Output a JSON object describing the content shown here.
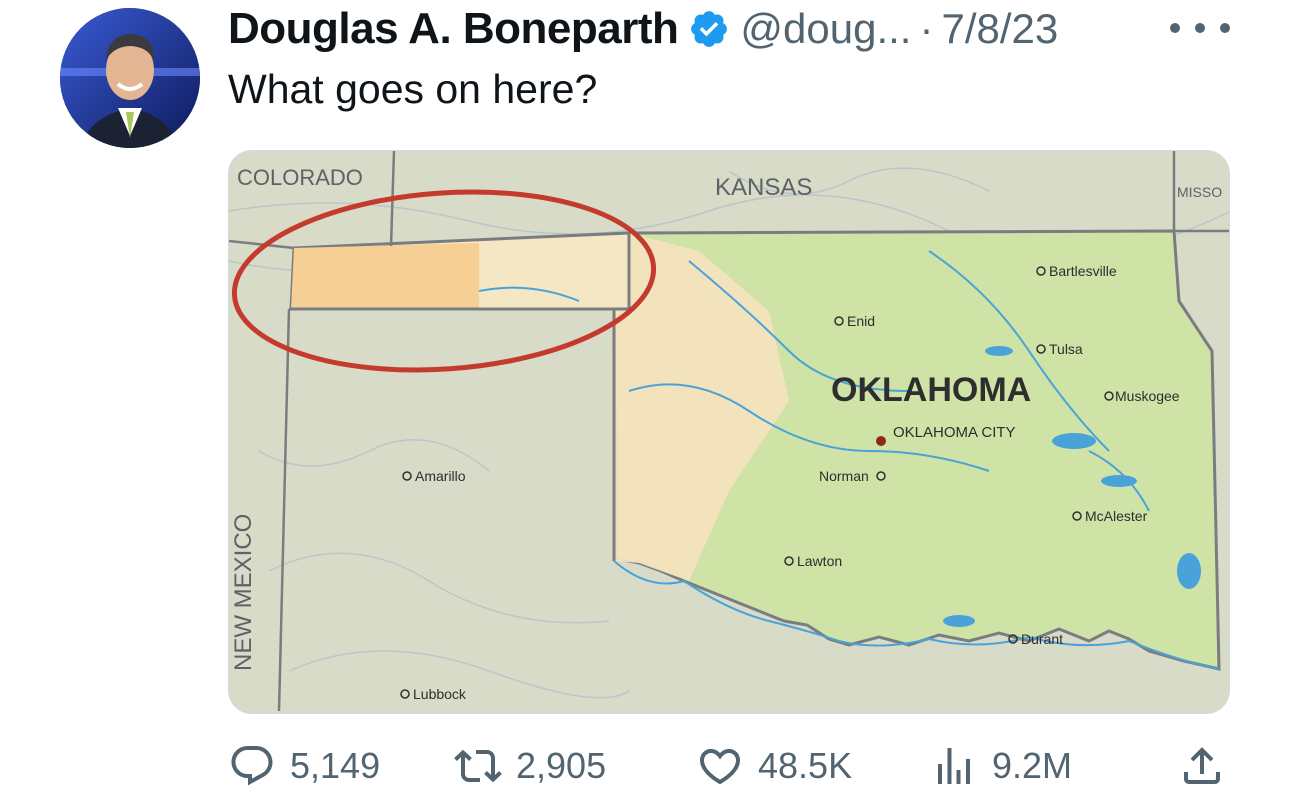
{
  "tweet": {
    "author_name": "Douglas A. Boneparth",
    "handle": "@doug...",
    "separator": "·",
    "date": "7/8/23",
    "text": "What goes on here?"
  },
  "map": {
    "labels": {
      "colorado": "COLORADO",
      "kansas": "KANSAS",
      "missouri": "MISSO",
      "new_mexico": "NEW MEXICO",
      "oklahoma": "OKLAHOMA",
      "oklahoma_city": "OKLAHOMA CITY",
      "enid": "Enid",
      "bartlesville": "Bartlesville",
      "tulsa": "Tulsa",
      "muskogee": "Muskogee",
      "norman": "Norman",
      "mcalester": "McAlester",
      "lawton": "Lawton",
      "durant": "Durant",
      "amarillo": "Amarillo",
      "lubbock": "Lubbock"
    },
    "colors": {
      "background": "#d9dcc9",
      "oklahoma_green": "#cfe3a6",
      "oklahoma_tan": "#f5e6c4",
      "panhandle_orange": "#f6cf94",
      "circle": "#c43a2c",
      "border": "#7a7d80",
      "water": "#4aa3d8"
    }
  },
  "actions": {
    "replies": "5,149",
    "retweets": "2,905",
    "likes": "48.5K",
    "views": "9.2M"
  },
  "colors": {
    "verified_blue": "#1d9bf0",
    "muted_text": "#536471",
    "primary_text": "#0f1419"
  }
}
